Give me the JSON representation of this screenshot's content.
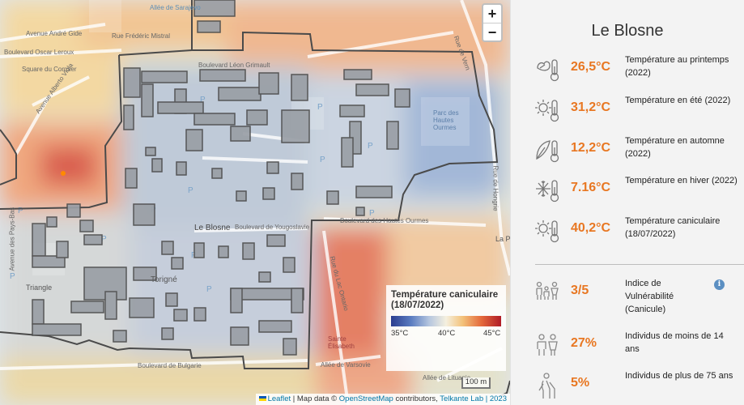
{
  "map": {
    "zoom_in": "+",
    "zoom_out": "−",
    "streets": [
      "Allée de Sarajevo",
      "Rue Frédéric Mistral",
      "Avenue André Gide",
      "Boulevard Oscar Leroux",
      "Boulevard Léon Grimault",
      "Square du Cormier",
      "Avenue Alberto Viola",
      "Avenue des Pays-Bas",
      "Le Blosne",
      "Boulevard de Yougoslavie",
      "Boulevard des Hautes Ourmes",
      "Parc des Hautes Ourmes",
      "Rue de Vern",
      "Rue de Hongrie",
      "Rue du Lac Ontario",
      "Sainte Élisabeth",
      "Allée de Varsovie",
      "Boulevard de Bulgarie",
      "Allée de Lituanie",
      "Triangle",
      "Torigné",
      "La Poterie"
    ],
    "legend": {
      "title": "Température caniculaire (18/07/2022)",
      "min": "35°C",
      "mid": "40°C",
      "max": "45°C"
    },
    "scale": "100 m",
    "attribution": {
      "leaflet": "Leaflet",
      "mid": "| Map data ©",
      "osm": "OpenStreetMap",
      "contrib": "contributors,",
      "telkante": "Telkante Lab",
      "year": "| 2023"
    }
  },
  "panel": {
    "title": "Le Blosne",
    "rows": [
      {
        "icon": "spring-thermometer-icon",
        "value": "26,5°C",
        "label": "Température au printemps (2022)"
      },
      {
        "icon": "summer-thermometer-icon",
        "value": "31,2°C",
        "label": "Température en été (2022)"
      },
      {
        "icon": "autumn-thermometer-icon",
        "value": "12,2°C",
        "label": "Température en automne (2022)"
      },
      {
        "icon": "winter-thermometer-icon",
        "value": "7.16°C",
        "label": "Température en hiver (2022)"
      },
      {
        "icon": "heatwave-thermometer-icon",
        "value": "40,2°C",
        "label": "Température caniculaire (18/07/2022)"
      },
      {
        "icon": "family-icon",
        "value": "3/5",
        "label": "Indice de Vulnérabilité (Canicule)"
      },
      {
        "icon": "children-icon",
        "value": "27%",
        "label": "Individus de moins de 14 ans"
      },
      {
        "icon": "elderly-icon",
        "value": "5%",
        "label": "Individus de plus de 75 ans"
      }
    ],
    "info": "i"
  },
  "colors": {
    "accent": "#e87722",
    "border": "#444444"
  }
}
